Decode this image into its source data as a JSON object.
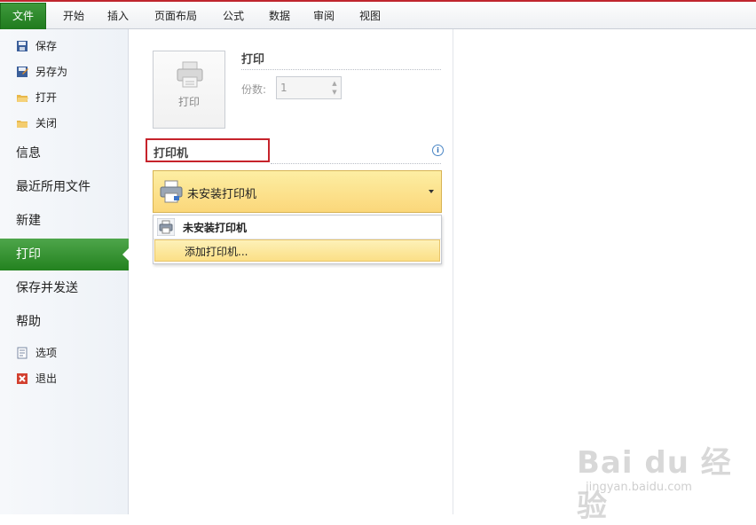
{
  "ribbon": {
    "tabs": [
      "文件",
      "开始",
      "插入",
      "页面布局",
      "公式",
      "数据",
      "审阅",
      "视图"
    ]
  },
  "sidebar": {
    "small_top": [
      {
        "label": "保存",
        "icon": "save-icon"
      },
      {
        "label": "另存为",
        "icon": "save-as-icon"
      },
      {
        "label": "打开",
        "icon": "open-folder-icon"
      },
      {
        "label": "关闭",
        "icon": "close-folder-icon"
      }
    ],
    "big": [
      {
        "label": "信息"
      },
      {
        "label": "最近所用文件"
      },
      {
        "label": "新建"
      },
      {
        "label": "打印",
        "active": true
      },
      {
        "label": "保存并发送"
      },
      {
        "label": "帮助"
      }
    ],
    "small_bottom": [
      {
        "label": "选项",
        "icon": "options-icon"
      },
      {
        "label": "退出",
        "icon": "exit-icon"
      }
    ]
  },
  "print": {
    "section_title": "打印",
    "button_label": "打印",
    "copies_label": "份数:",
    "copies_value": "1"
  },
  "printer": {
    "section_title": "打印机",
    "selected": "未安装打印机",
    "menu_items": [
      "未安装打印机",
      "添加打印机..."
    ]
  },
  "watermark": {
    "brand": "Bai du 经验",
    "url": "jingyan.baidu.com"
  },
  "colors": {
    "file_tab": "#2a872a",
    "active_nav": "#2f8a2c",
    "highlight_box": "#c6232b",
    "dropdown": "#fbd77a"
  }
}
